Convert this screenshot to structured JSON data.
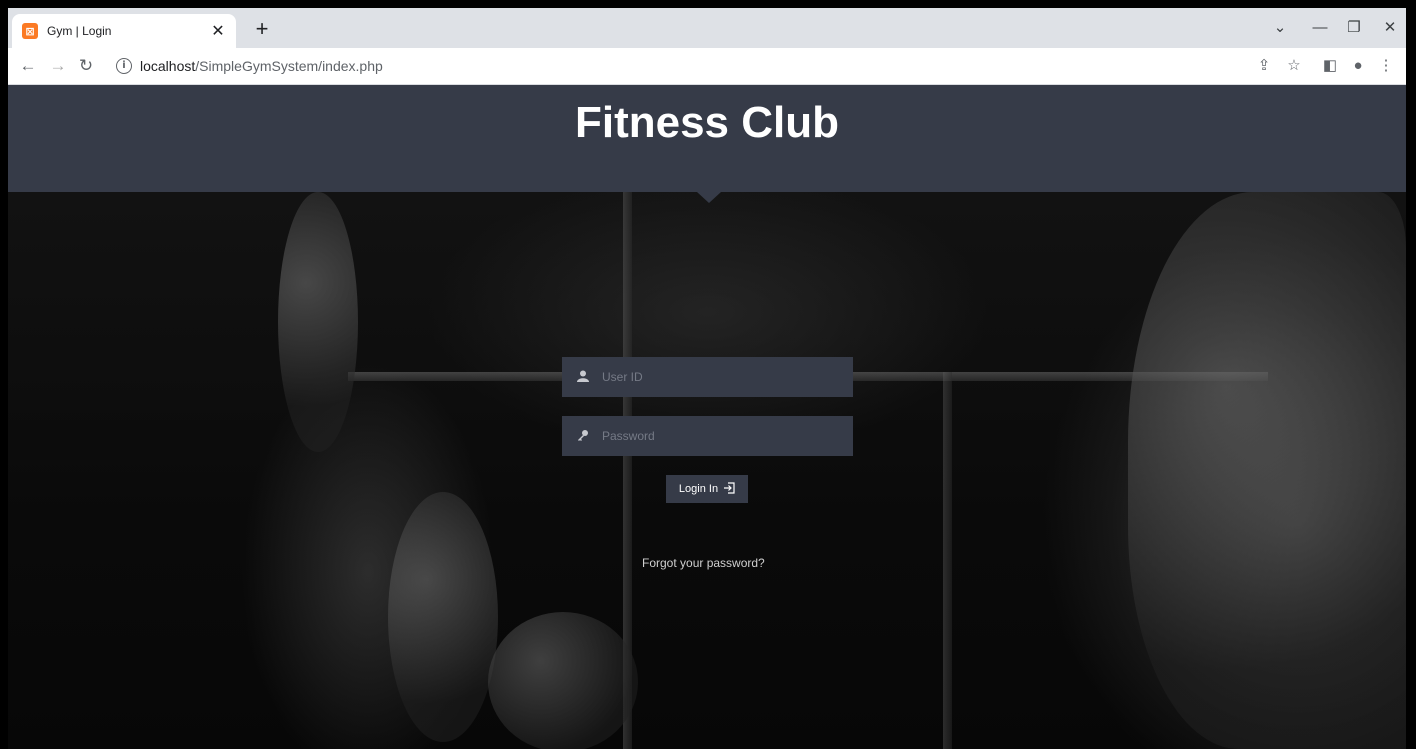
{
  "browser": {
    "tab": {
      "title": "Gym | Login",
      "favicon": "xampp-icon"
    },
    "address": {
      "host": "localhost",
      "path": "/SimpleGymSystem/index.php"
    }
  },
  "header": {
    "title": "Fitness Club"
  },
  "login": {
    "user_placeholder": "User ID",
    "password_placeholder": "Password",
    "button_label": "Login In",
    "forgot_link": "Forgot your password?"
  },
  "colors": {
    "header_bg": "#363b48",
    "field_bg": "#363b48"
  }
}
